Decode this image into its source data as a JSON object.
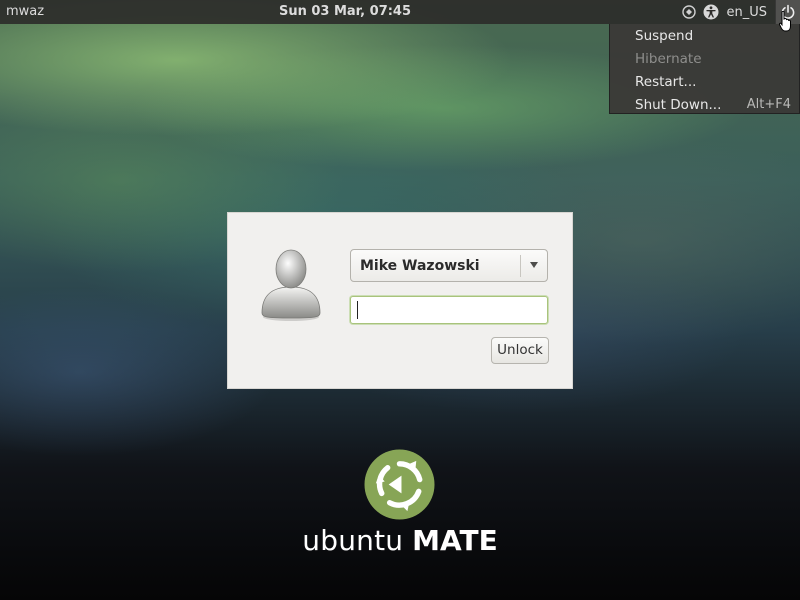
{
  "top_panel": {
    "username": "mwaz",
    "datetime": "Sun 03 Mar, 07:45",
    "language": "en_US",
    "icons": [
      "network-icon",
      "accessibility-icon",
      "power-icon"
    ]
  },
  "power_menu": {
    "items": [
      {
        "label": "Suspend",
        "enabled": true,
        "accelerator": ""
      },
      {
        "label": "Hibernate",
        "enabled": false,
        "accelerator": ""
      },
      {
        "label": "Restart...",
        "enabled": true,
        "accelerator": ""
      },
      {
        "label": "Shut Down...",
        "enabled": true,
        "accelerator": "Alt+F4"
      }
    ]
  },
  "login": {
    "selected_user": "Mike Wazowski",
    "password_value": "",
    "unlock_label": "Unlock"
  },
  "branding": {
    "word1": "ubuntu",
    "word2": "MATE",
    "logo_color": "#87a556"
  }
}
